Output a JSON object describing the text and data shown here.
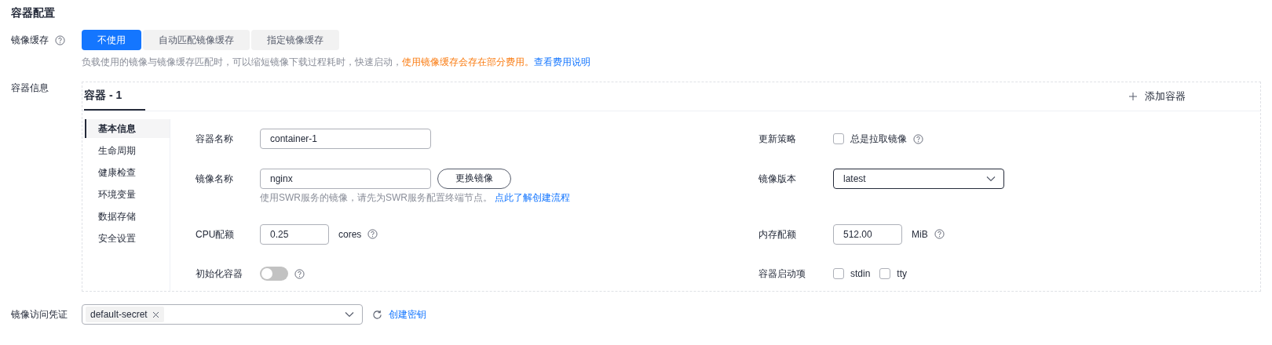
{
  "section_title": "容器配置",
  "image_cache": {
    "label": "镜像缓存",
    "options": [
      {
        "label": "不使用",
        "selected": true
      },
      {
        "label": "自动匹配镜像缓存",
        "selected": false
      },
      {
        "label": "指定镜像缓存",
        "selected": false
      }
    ],
    "hint": [
      {
        "kind": "text",
        "text": "负载使用的镜像与镜像缓存匹配时，可以缩短镜像下载过程耗时，快速启动，"
      },
      {
        "kind": "warning",
        "text": "使用镜像缓存会存在部分费用。"
      },
      {
        "kind": "link",
        "text": "查看费用说明"
      }
    ]
  },
  "container_info": {
    "label": "容器信息",
    "tabs": [
      {
        "label": "容器 - 1",
        "selected": true
      }
    ],
    "add_button": "添加容器",
    "side_menu": [
      {
        "label": "基本信息",
        "selected": true
      },
      {
        "label": "生命周期",
        "selected": false
      },
      {
        "label": "健康检查",
        "selected": false
      },
      {
        "label": "环境变量",
        "selected": false
      },
      {
        "label": "数据存储",
        "selected": false
      },
      {
        "label": "安全设置",
        "selected": false
      }
    ],
    "form": {
      "container_name": {
        "label": "容器名称",
        "value": "container-1"
      },
      "image_name": {
        "label": "镜像名称",
        "value": "nginx",
        "button": "更换镜像",
        "hint": "使用SWR服务的镜像，请先为SWR服务配置终端节点。",
        "hint_link": "点此了解创建流程"
      },
      "cpu": {
        "label": "CPU配额",
        "value": "0.25",
        "unit": "cores"
      },
      "init_container": {
        "label": "初始化容器",
        "on": false
      },
      "update_policy": {
        "label": "更新策略",
        "option": "总是拉取镜像",
        "checked": false
      },
      "image_version": {
        "label": "镜像版本",
        "value": "latest"
      },
      "memory": {
        "label": "内存配额",
        "value": "512.00",
        "unit": "MiB"
      },
      "startup_options": {
        "label": "容器启动项",
        "options": [
          {
            "label": "stdin",
            "checked": false
          },
          {
            "label": "tty",
            "checked": false
          }
        ]
      }
    }
  },
  "credentials": {
    "label": "镜像访问凭证",
    "tags": [
      "default-secret"
    ],
    "link": "创建密钥"
  }
}
